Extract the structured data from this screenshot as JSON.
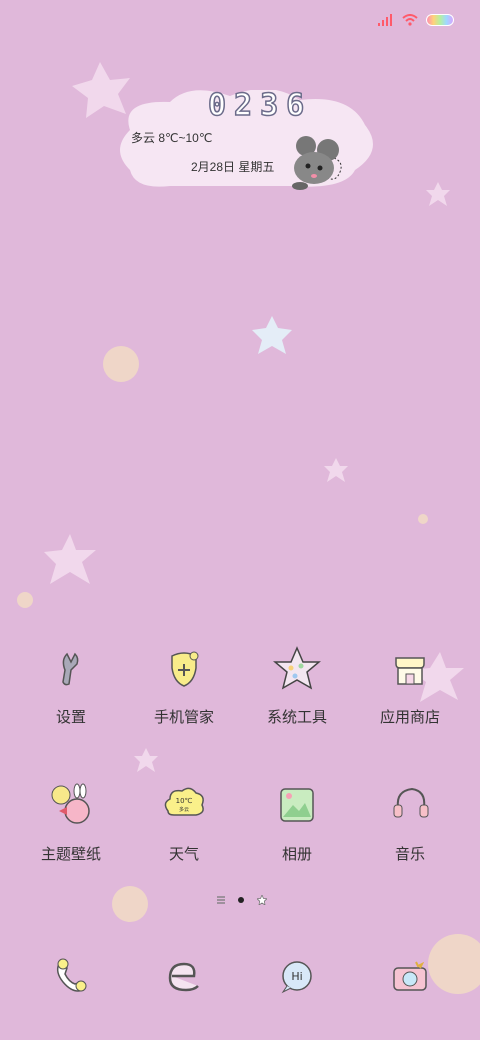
{
  "status": {
    "signal_icon": "signal-icon",
    "wifi_icon": "wifi-icon",
    "battery_icon": "battery-icon"
  },
  "widget": {
    "time_digits": "0236",
    "weather": "多云 8℃~10℃",
    "date": "2月28日 星期五",
    "mascot_icon": "mouse-icon"
  },
  "apps_row1": [
    {
      "label": "设置",
      "icon": "wrench-icon"
    },
    {
      "label": "手机管家",
      "icon": "shield-icon"
    },
    {
      "label": "系统工具",
      "icon": "star-folder-icon"
    },
    {
      "label": "应用商店",
      "icon": "shop-icon"
    }
  ],
  "apps_row2": [
    {
      "label": "主题壁纸",
      "icon": "balloon-bunny-icon"
    },
    {
      "label": "天气",
      "icon": "cloud-weather-icon",
      "badge": "10℃ 多云"
    },
    {
      "label": "相册",
      "icon": "photo-icon"
    },
    {
      "label": "音乐",
      "icon": "headphones-icon"
    }
  ],
  "pager": {
    "pages": 3,
    "active": 1
  },
  "dock": [
    {
      "icon": "phone-icon"
    },
    {
      "icon": "browser-icon"
    },
    {
      "icon": "messages-icon",
      "text": "Hi"
    },
    {
      "icon": "camera-icon"
    }
  ],
  "colors": {
    "background": "#e0b8da",
    "cloud": "#f6e6f3",
    "dot": "#f0d9c5"
  }
}
